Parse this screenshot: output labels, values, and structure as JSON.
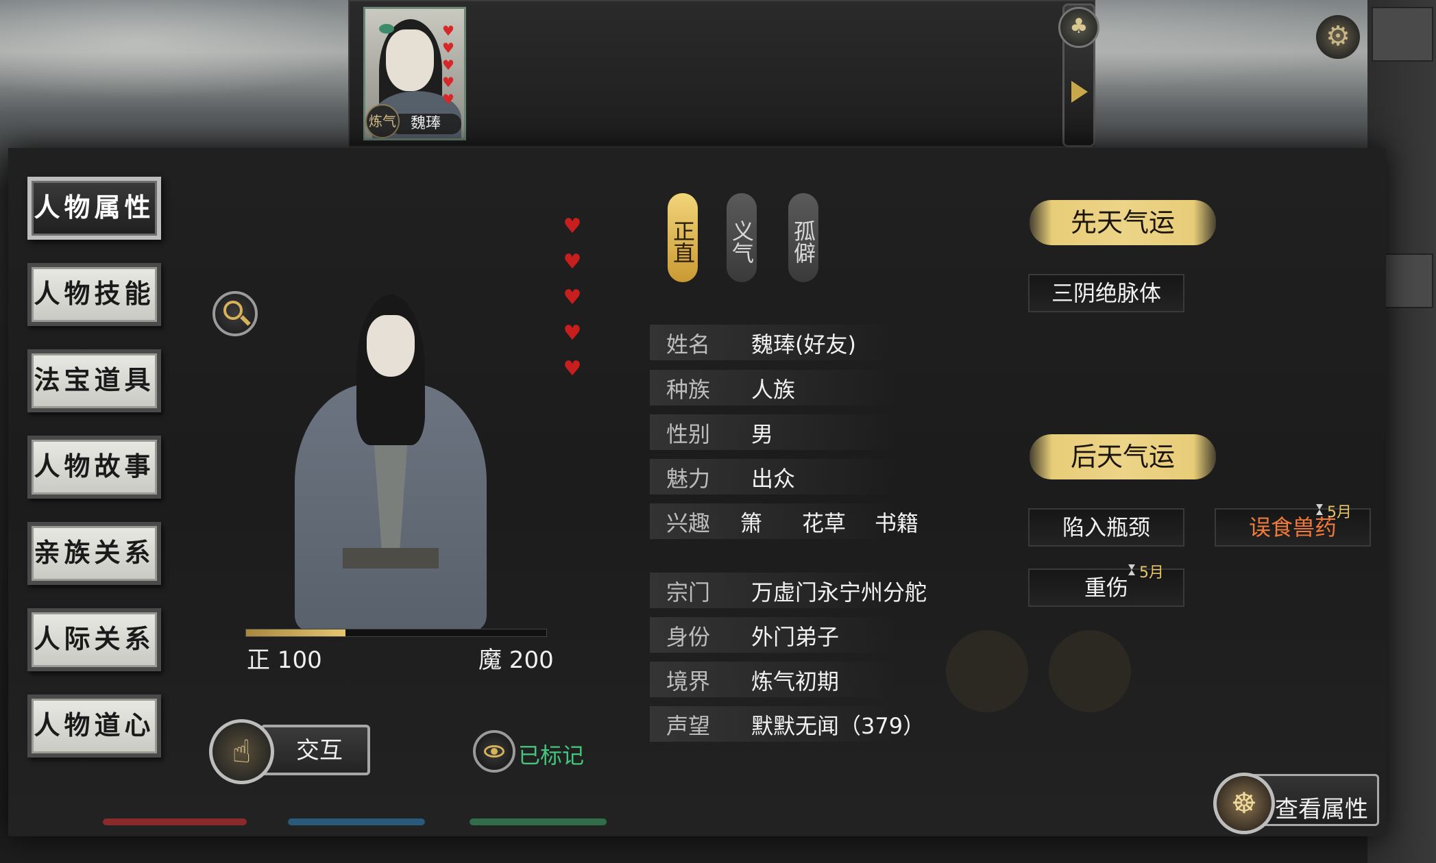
{
  "top": {
    "character_name": "魏琫",
    "card_badge": "炼气",
    "card_hearts": [
      "♥",
      "♥",
      "♥",
      "♥",
      "♥"
    ]
  },
  "menu": {
    "items": [
      {
        "label": "人物属性",
        "active": true
      },
      {
        "label": "人物技能"
      },
      {
        "label": "法宝道具"
      },
      {
        "label": "人物故事"
      },
      {
        "label": "亲族关系"
      },
      {
        "label": "人际关系"
      },
      {
        "label": "人物道心"
      }
    ]
  },
  "affinity_hearts": [
    "♥",
    "♥",
    "♥",
    "♥",
    "♥"
  ],
  "traits": [
    {
      "label": "正直",
      "highlight": true
    },
    {
      "label": "义气"
    },
    {
      "label": "孤僻"
    }
  ],
  "info": {
    "name_label": "姓名",
    "name_value": "魏琫(好友)",
    "race_label": "种族",
    "race_value": "人族",
    "gender_label": "性别",
    "gender_value": "男",
    "charm_label": "魅力",
    "charm_value": "出众",
    "hobby_label": "兴趣",
    "hobbies": [
      "箫",
      "花草",
      "书籍"
    ],
    "sect_label": "宗门",
    "sect_value": "万虚门永宁州分舵",
    "identity_label": "身份",
    "identity_value": "外门弟子",
    "realm_label": "境界",
    "realm_value": "炼气初期",
    "reputation_label": "声望",
    "reputation_value": "默默无闻（379）"
  },
  "alignment": {
    "righteous_label": "正 100",
    "demonic_label": "魔 200",
    "fill_ratio": 0.33
  },
  "actions": {
    "interact_label": "交互",
    "marked_label": "已标记",
    "view_attributes_label": "查看属性"
  },
  "fortune": {
    "innate_title": "先天气运",
    "innate_tags": [
      "三阴绝脉体"
    ],
    "acquired_title": "后天气运",
    "acquired_tags": [
      {
        "label": "陷入瓶颈"
      },
      {
        "label": "误食兽药",
        "month": "5月",
        "bad": true
      },
      {
        "label": "重伤",
        "month": "5月"
      }
    ]
  },
  "colors": {
    "gold": "#e8cd78",
    "heart": "#c81e1e",
    "marked_green": "#45c57d",
    "bad_orange": "#f07a3a"
  }
}
